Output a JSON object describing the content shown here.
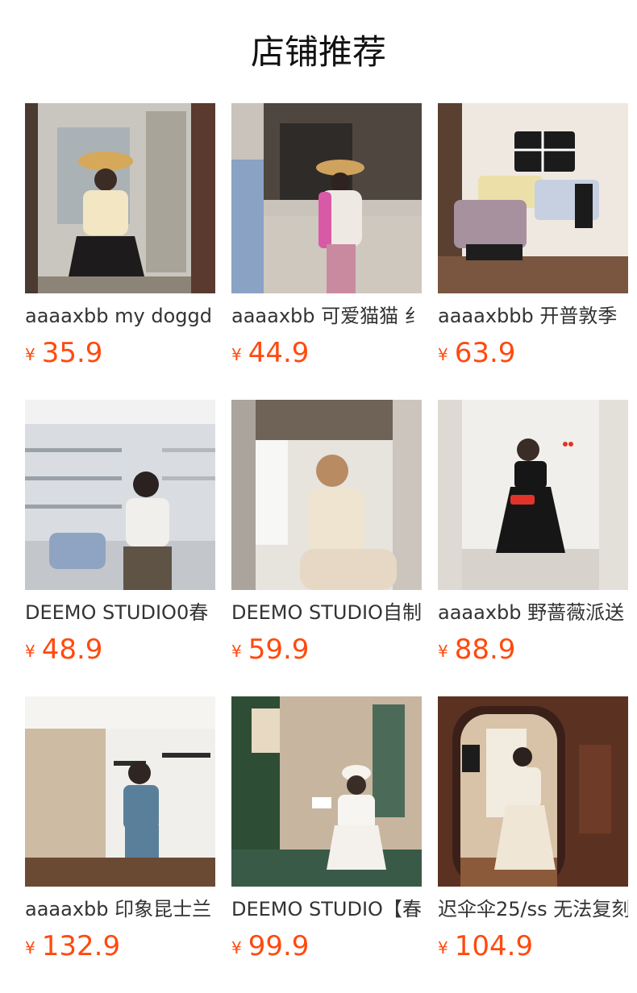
{
  "header": {
    "title": "店铺推荐"
  },
  "currency_symbol": "¥",
  "products": [
    {
      "name": "aaaaxbb my doggd",
      "price": "35.9"
    },
    {
      "name": "aaaaxbb 可爱猫猫 纟",
      "price": "44.9"
    },
    {
      "name": "aaaaxbbb 开普敦季",
      "price": "63.9"
    },
    {
      "name": "DEEMO STUDIO0春",
      "price": "48.9"
    },
    {
      "name": "DEEMO STUDIO自制",
      "price": "59.9"
    },
    {
      "name": "aaaaxbb 野蔷薇派送",
      "price": "88.9"
    },
    {
      "name": "aaaaxbb 印象昆士兰",
      "price": "132.9"
    },
    {
      "name": "DEEMO STUDIO【春",
      "price": "99.9"
    },
    {
      "name": "迟伞伞25/ss 无法复刻",
      "price": "104.9"
    }
  ]
}
